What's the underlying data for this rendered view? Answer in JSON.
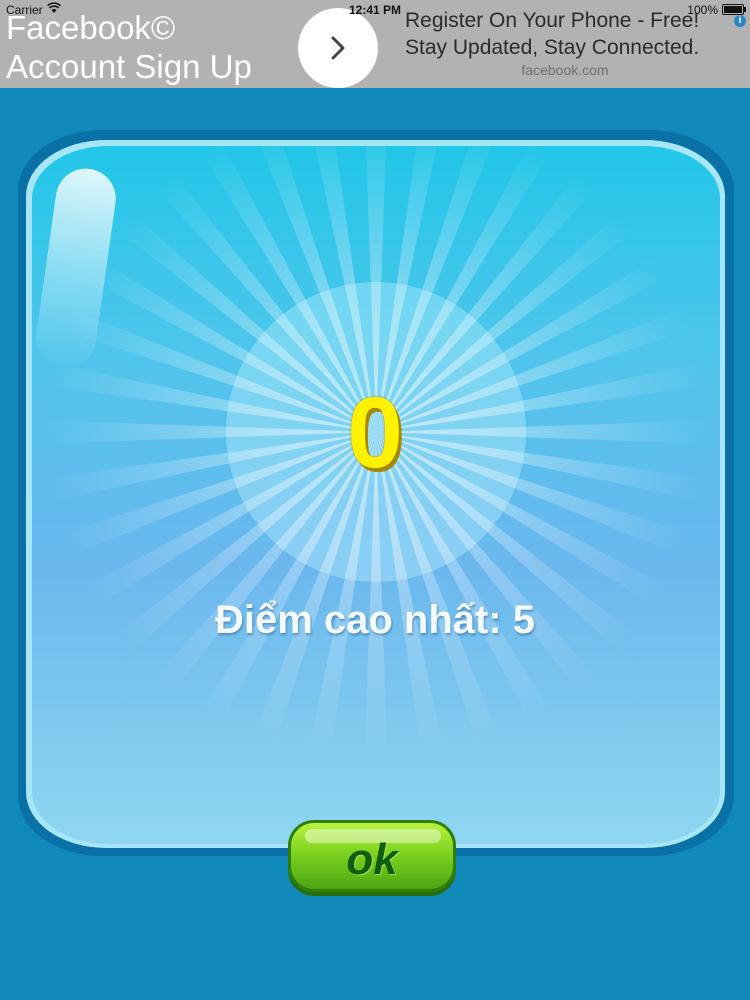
{
  "status_bar": {
    "carrier": "Carrier",
    "time": "12:41 PM",
    "battery": "100%"
  },
  "ad": {
    "title_line1": "Facebook©",
    "title_line2": "Account Sign Up",
    "headline": "Register On Your Phone - Free!",
    "subline": "Stay Updated, Stay Connected.",
    "domain": "facebook.com",
    "info_glyph": "i",
    "arrow_icon": "chevron-right-icon"
  },
  "game": {
    "score": "0",
    "best_score_label": "Điểm cao nhất: 5",
    "ok_label": "ok"
  },
  "colors": {
    "background": "#1289bb",
    "score": "#fff200",
    "ok_button": "#7ed321"
  }
}
